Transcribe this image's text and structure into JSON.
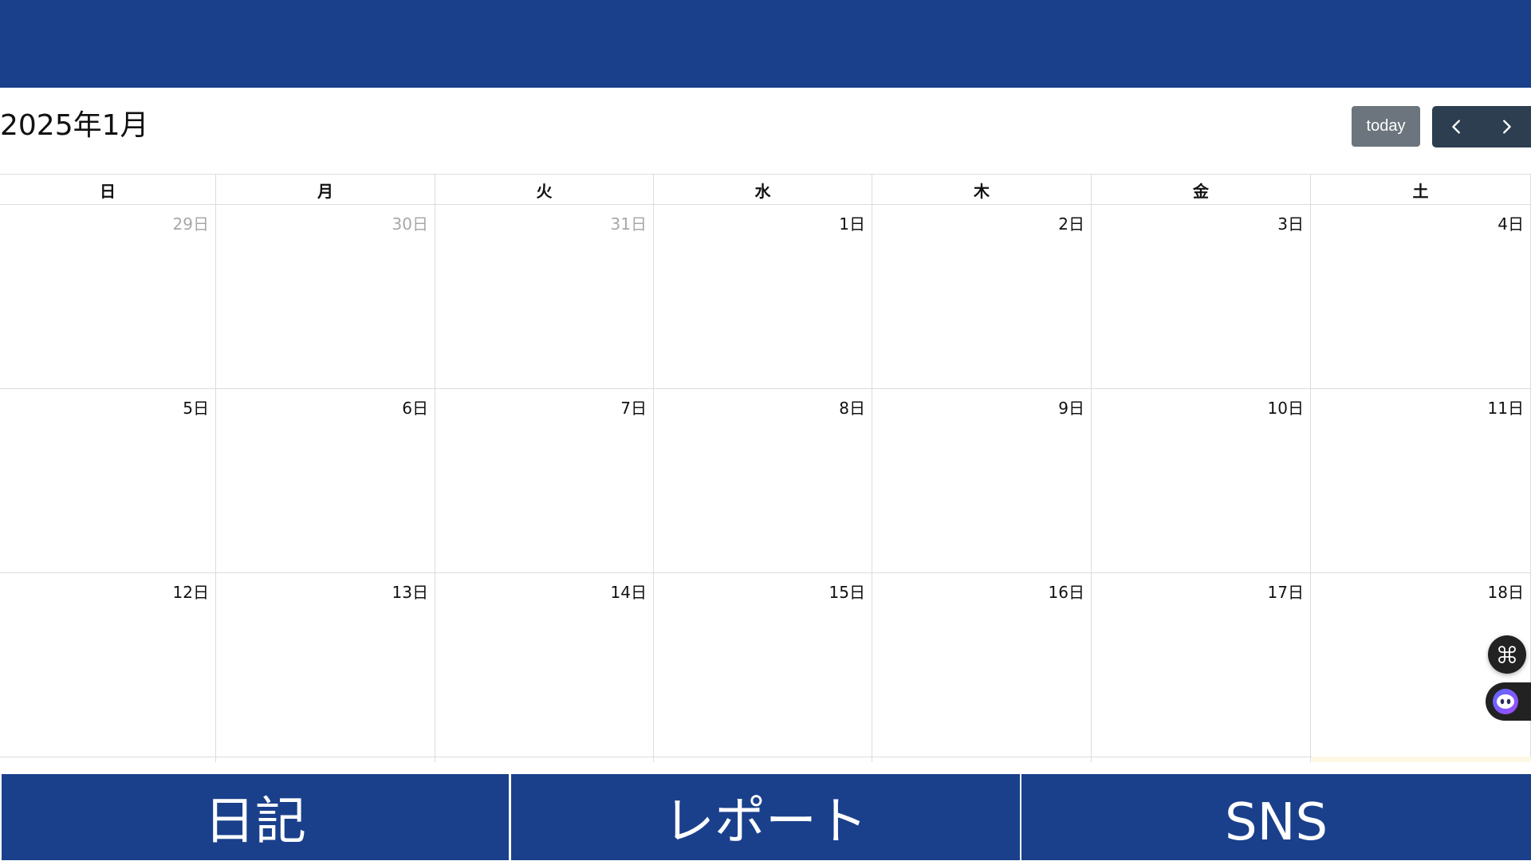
{
  "header": {
    "brand_color": "#1a408c"
  },
  "calendar": {
    "title": "2025年1月",
    "today_label": "today",
    "prev_icon": "chevron-left-icon",
    "next_icon": "chevron-right-icon",
    "weekdays": [
      "日",
      "月",
      "火",
      "水",
      "木",
      "金",
      "土"
    ],
    "weeks": [
      [
        {
          "label": "29日",
          "other_month": true
        },
        {
          "label": "30日",
          "other_month": true
        },
        {
          "label": "31日",
          "other_month": true
        },
        {
          "label": "1日",
          "other_month": false
        },
        {
          "label": "2日",
          "other_month": false
        },
        {
          "label": "3日",
          "other_month": false
        },
        {
          "label": "4日",
          "other_month": false
        }
      ],
      [
        {
          "label": "5日",
          "other_month": false
        },
        {
          "label": "6日",
          "other_month": false
        },
        {
          "label": "7日",
          "other_month": false
        },
        {
          "label": "8日",
          "other_month": false
        },
        {
          "label": "9日",
          "other_month": false
        },
        {
          "label": "10日",
          "other_month": false
        },
        {
          "label": "11日",
          "other_month": false
        }
      ],
      [
        {
          "label": "12日",
          "other_month": false
        },
        {
          "label": "13日",
          "other_month": false
        },
        {
          "label": "14日",
          "other_month": false
        },
        {
          "label": "15日",
          "other_month": false
        },
        {
          "label": "16日",
          "other_month": false
        },
        {
          "label": "17日",
          "other_month": false
        },
        {
          "label": "18日",
          "other_month": false
        }
      ]
    ]
  },
  "floating": {
    "grid_icon": "command-icon",
    "assistant_icon": "bot-icon"
  },
  "bottom_nav": {
    "items": [
      {
        "label": "日記"
      },
      {
        "label": "レポート"
      },
      {
        "label": "SNS"
      }
    ]
  }
}
